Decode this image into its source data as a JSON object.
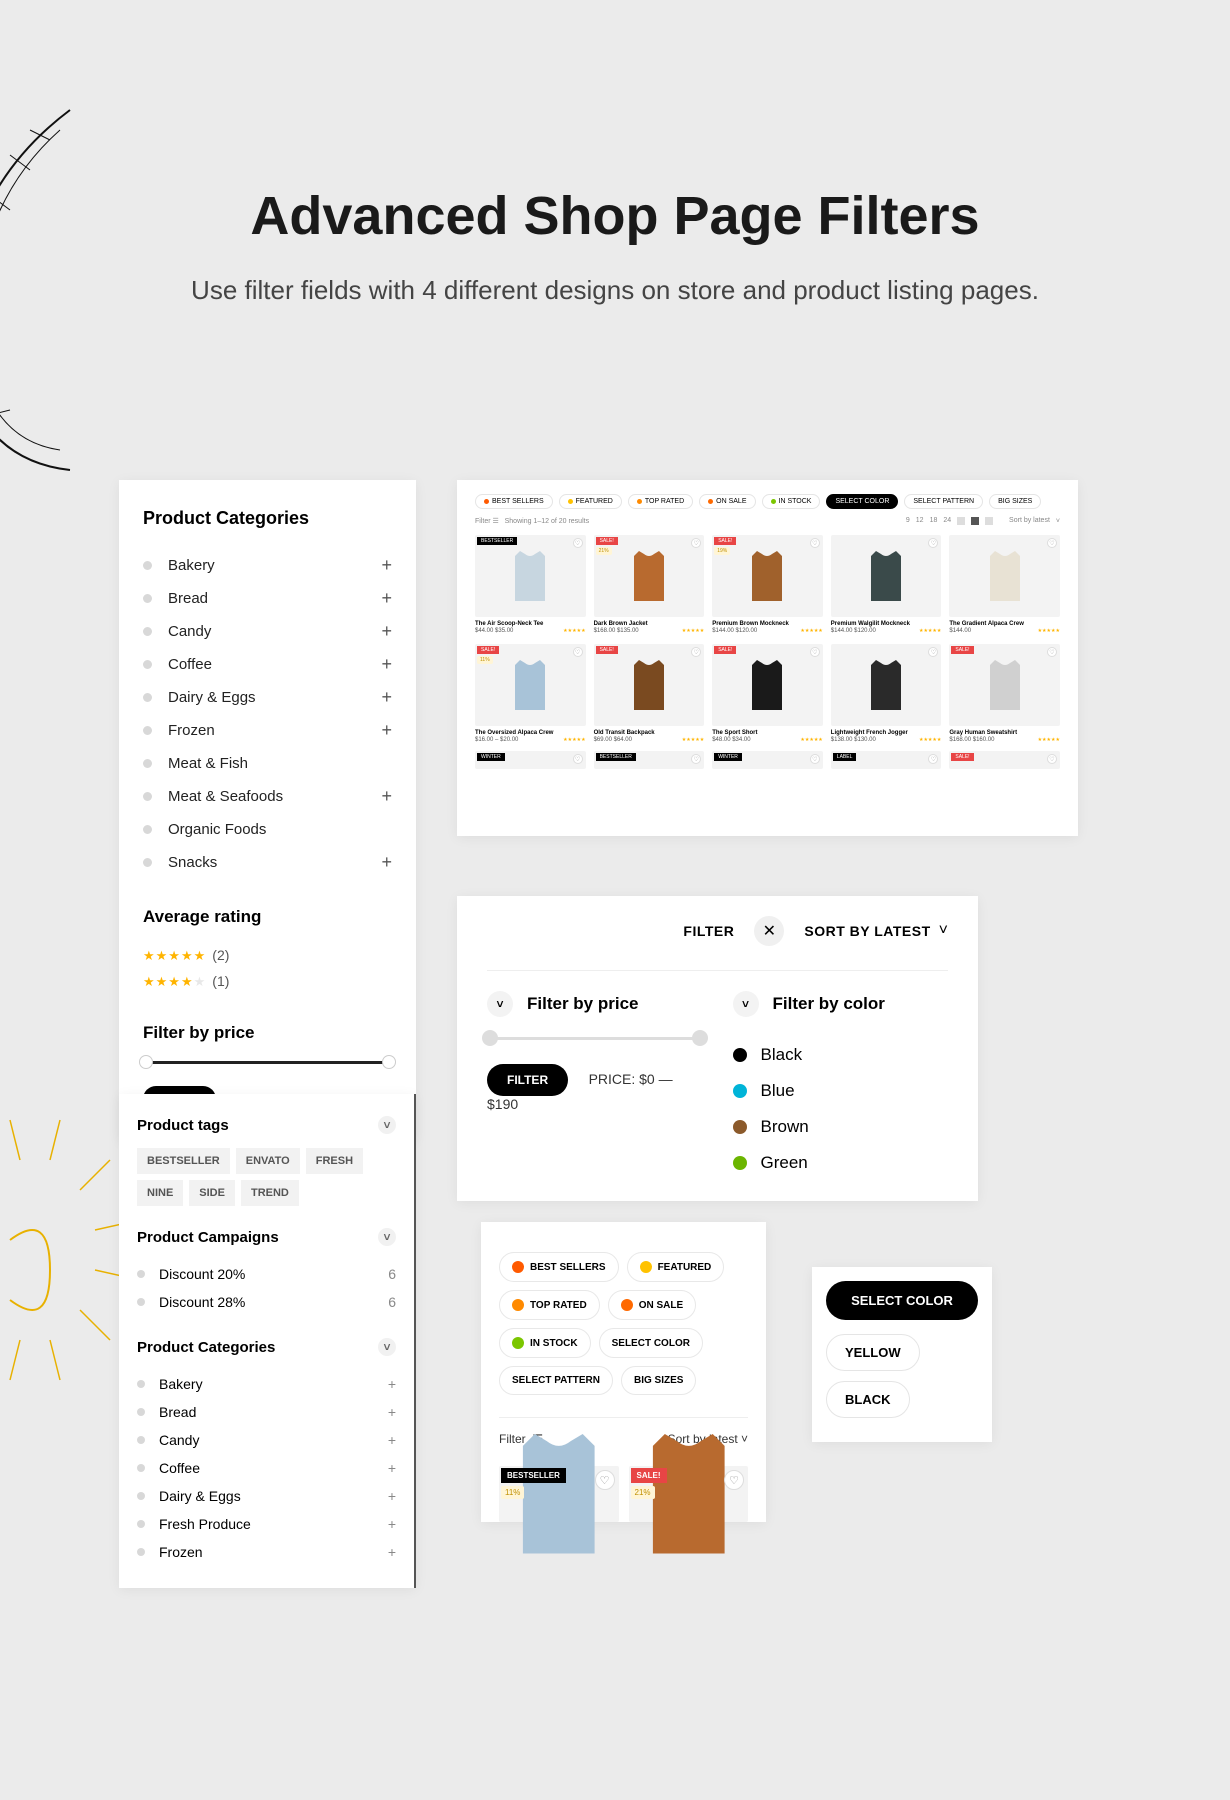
{
  "hero": {
    "title": "Advanced Shop Page Filters",
    "subtitle": "Use filter fields with 4 different designs on store and product listing pages."
  },
  "panel1": {
    "cat_title": "Product Categories",
    "categories": [
      {
        "name": "Bakery",
        "expand": true
      },
      {
        "name": "Bread",
        "expand": true
      },
      {
        "name": "Candy",
        "expand": true
      },
      {
        "name": "Coffee",
        "expand": true
      },
      {
        "name": "Dairy & Eggs",
        "expand": true
      },
      {
        "name": "Frozen",
        "expand": true
      },
      {
        "name": "Meat & Fish",
        "expand": false
      },
      {
        "name": "Meat & Seafoods",
        "expand": true
      },
      {
        "name": "Organic Foods",
        "expand": false
      },
      {
        "name": "Snacks",
        "expand": true
      }
    ],
    "rating_title": "Average rating",
    "ratings": [
      {
        "stars": 5,
        "count": "(2)"
      },
      {
        "stars": 4,
        "count": "(1)"
      }
    ],
    "price_title": "Filter by price",
    "filter_btn": "FILTER",
    "price_text": "PRICE: $0 — $190"
  },
  "panel2": {
    "pills": [
      {
        "label": "BEST SELLERS",
        "dot": "#ff5a00"
      },
      {
        "label": "FEATURED",
        "dot": "#ffc200"
      },
      {
        "label": "TOP RATED",
        "dot": "#ff8a00"
      },
      {
        "label": "ON SALE",
        "dot": "#ff6900"
      },
      {
        "label": "IN STOCK",
        "dot": "#7bc600"
      }
    ],
    "pillsDark": [
      "SELECT COLOR"
    ],
    "pillsMore": [
      "SELECT PATTERN",
      "BIG SIZES"
    ],
    "dd": [
      "YELLOW",
      "BLACK"
    ],
    "toolbar_left": "Filter",
    "toolbar_results": "Showing 1–12 of 20 results",
    "toolbar_cols": [
      "9",
      "12",
      "18",
      "24"
    ],
    "toolbar_sort": "Sort by latest",
    "products": [
      {
        "name": "The Air Scoop-Neck Tee",
        "price": "$44.00 $35.00",
        "badge": "BESTSELLER",
        "color": "#c7d6e0"
      },
      {
        "name": "Dark Brown Jacket",
        "price": "$168.00 $135.00",
        "badge": "SALE!",
        "pct": "21%",
        "color": "#b86a2f"
      },
      {
        "name": "Premium Brown Mockneck",
        "price": "$144.00 $120.00",
        "badge": "SALE!",
        "pct": "19%",
        "color": "#a0612c"
      },
      {
        "name": "Premium Walgilit Mockneck",
        "price": "$144.00 $120.00",
        "color": "#3a4a4a"
      },
      {
        "name": "The Gradient Alpaca Crew",
        "price": "$144.00",
        "color": "#e8e2d4"
      },
      {
        "name": "The Oversized Alpaca Crew",
        "price": "$16.00 – $20.00",
        "badge": "SALE!",
        "pct": "11%",
        "color": "#a8c3d8"
      },
      {
        "name": "Old Transit Backpack",
        "price": "$69.00 $64.00",
        "badge": "SALE!",
        "color": "#7a4a20"
      },
      {
        "name": "The Sport Short",
        "price": "$48.00 $34.00",
        "badge": "SALE!",
        "color": "#1a1a1a"
      },
      {
        "name": "Lightweight French Jogger",
        "price": "$138.00 $130.00",
        "color": "#2a2a2a"
      },
      {
        "name": "Gray Human Sweatshirt",
        "price": "$168.00 $160.00",
        "badge": "SALE!",
        "color": "#d0d0d0"
      }
    ],
    "row3_badges": [
      "WINTER",
      "BESTSELLER",
      "WINTER",
      "LABEL",
      "SALE!"
    ]
  },
  "panel3": {
    "filter_label": "FILTER",
    "sort_label": "SORT BY LATEST",
    "price_title": "Filter by price",
    "color_title": "Filter by color",
    "filter_btn": "FILTER",
    "price_text": "PRICE: $0 — $190",
    "colors": [
      {
        "name": "Black",
        "hex": "#000000"
      },
      {
        "name": "Blue",
        "hex": "#00b4d8"
      },
      {
        "name": "Brown",
        "hex": "#8b5a2b"
      },
      {
        "name": "Green",
        "hex": "#6bb500"
      }
    ]
  },
  "panel4": {
    "tags_title": "Product tags",
    "tags": [
      "BESTSELLER",
      "ENVATO",
      "FRESH",
      "NINE",
      "SIDE",
      "TREND"
    ],
    "camp_title": "Product Campaigns",
    "campaigns": [
      {
        "name": "Discount 20%",
        "count": "6"
      },
      {
        "name": "Discount 28%",
        "count": "6"
      }
    ],
    "cat_title": "Product Categories",
    "categories": [
      {
        "name": "Bakery"
      },
      {
        "name": "Bread"
      },
      {
        "name": "Candy"
      },
      {
        "name": "Coffee"
      },
      {
        "name": "Dairy & Eggs"
      },
      {
        "name": "Fresh Produce"
      },
      {
        "name": "Frozen"
      }
    ]
  },
  "panel5": {
    "pills": [
      {
        "label": "BEST SELLERS",
        "ico": "#ff5a00"
      },
      {
        "label": "FEATURED",
        "ico": "#ffc200"
      },
      {
        "label": "TOP RATED",
        "ico": "#ff8a00"
      },
      {
        "label": "ON SALE",
        "ico": "#ff6900"
      },
      {
        "label": "IN STOCK",
        "ico": "#7bc600"
      },
      {
        "label": "SELECT COLOR"
      },
      {
        "label": "SELECT PATTERN"
      },
      {
        "label": "BIG SIZES"
      }
    ],
    "filter_label": "Filter",
    "sort_label": "Sort by latest",
    "products": [
      {
        "badge": "BESTSELLER",
        "bg": "#000",
        "pct": "11%",
        "color": "#a8c3d8"
      },
      {
        "badge": "SALE!",
        "bg": "#e84545",
        "pct": "21%",
        "color": "#b86a2f"
      }
    ]
  },
  "panel6": {
    "title": "SELECT COLOR",
    "options": [
      "YELLOW",
      "BLACK"
    ]
  }
}
